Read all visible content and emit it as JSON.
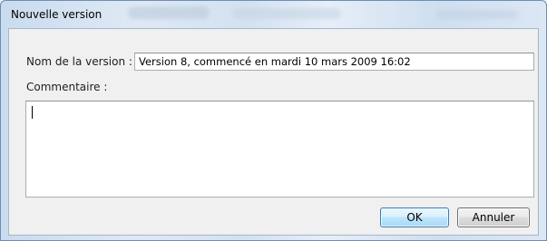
{
  "window": {
    "title": "Nouvelle version"
  },
  "form": {
    "name_label": "Nom de la version :",
    "name_value": "Version 8, commencé en mardi 10 mars 2009 16:02",
    "comment_label": "Commentaire :",
    "comment_value": ""
  },
  "buttons": {
    "ok_label": "OK",
    "cancel_label": "Annuler"
  },
  "colors": {
    "titlebar": "#d3e1f0",
    "window_border": "#6d8fb4",
    "dialog_background": "#f0f0f0",
    "default_button_border": "#3c7fb1"
  }
}
